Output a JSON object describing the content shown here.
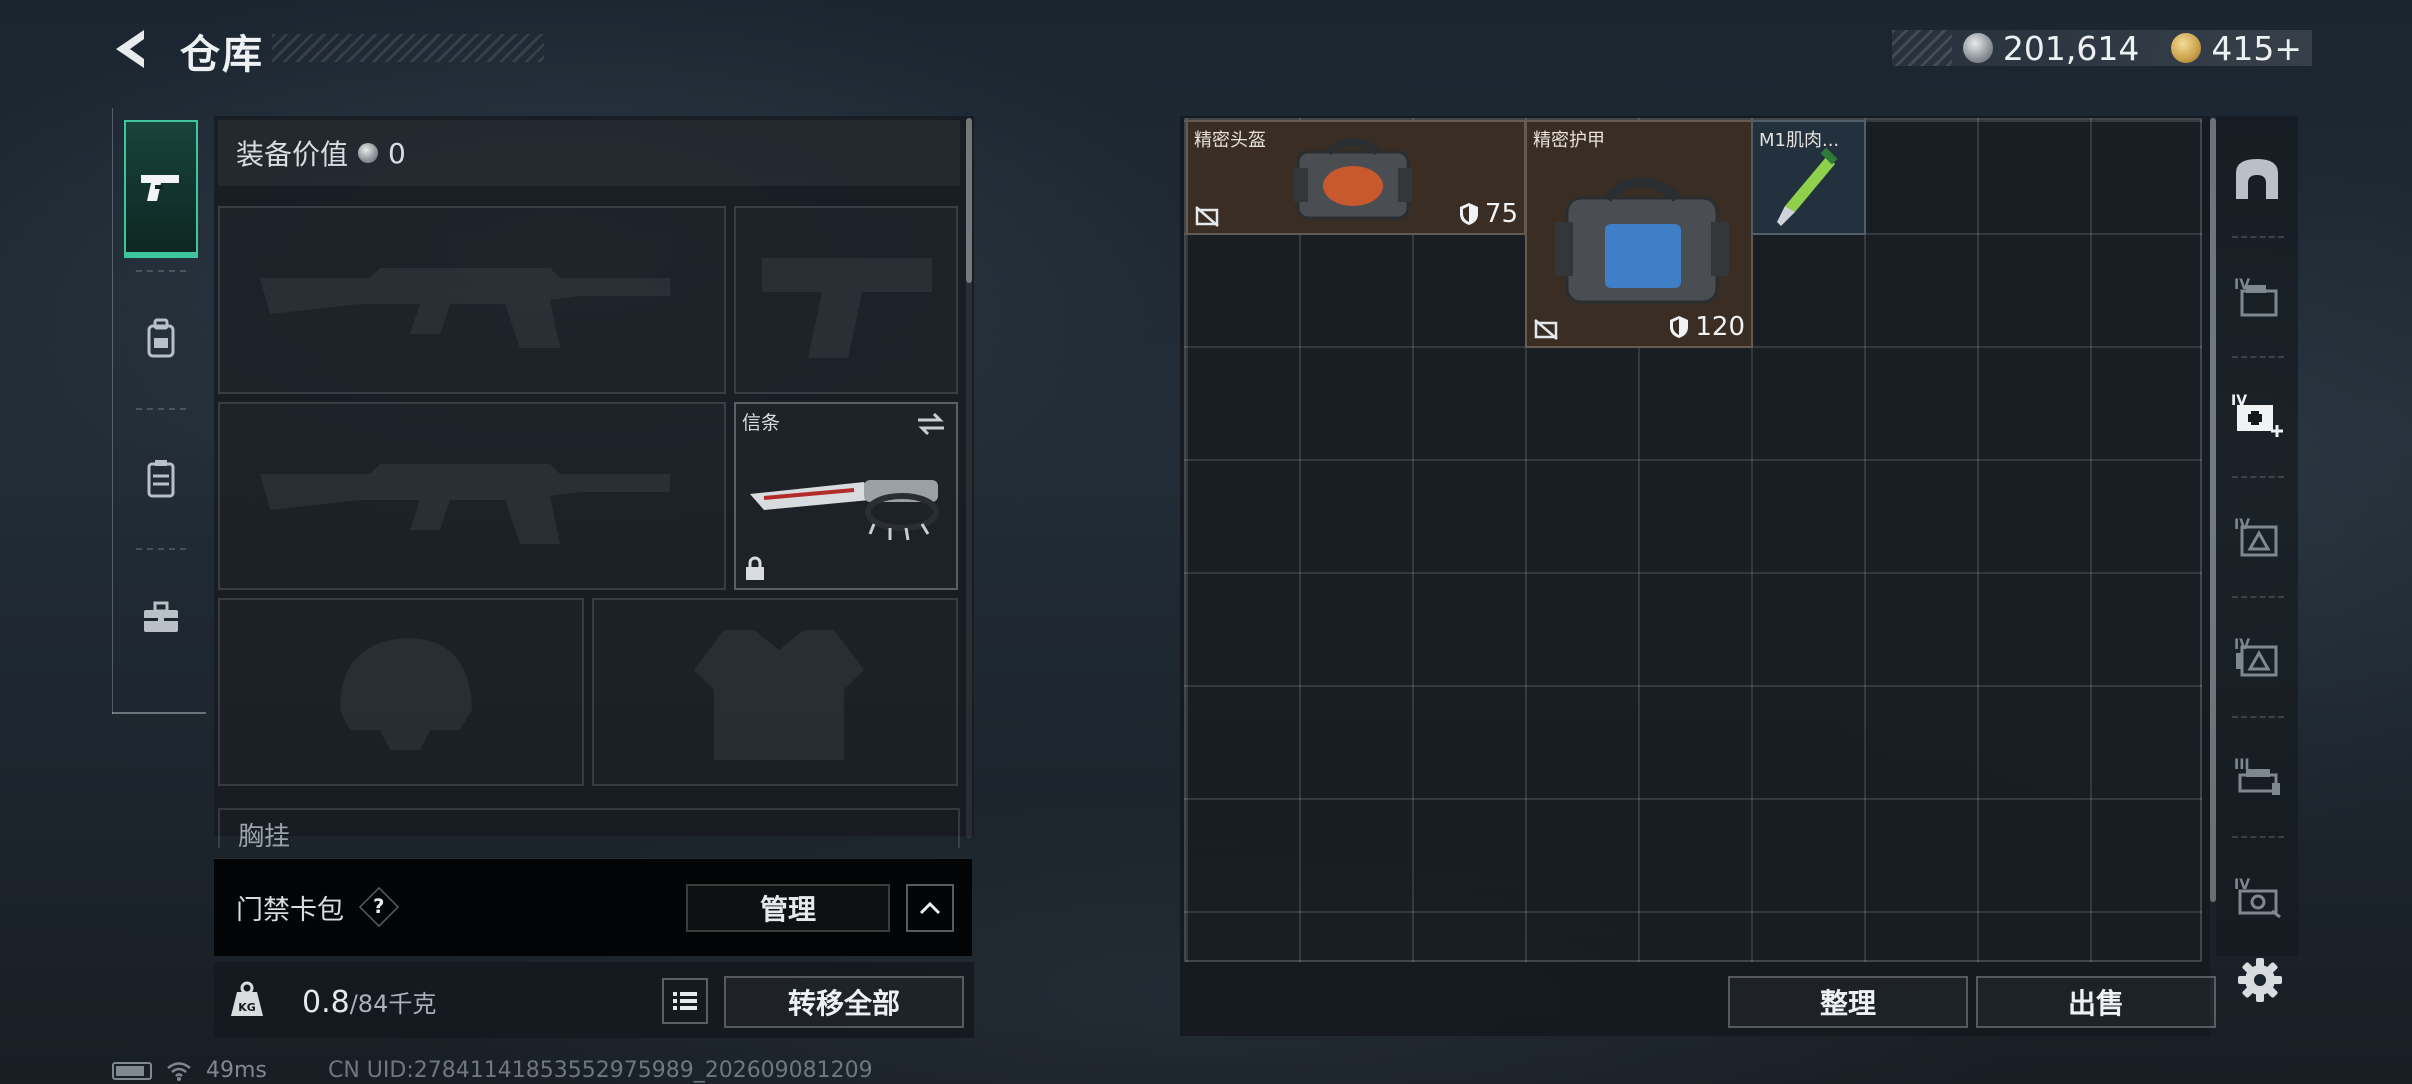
{
  "header": {
    "title": "仓库",
    "currency_silver": "201,614",
    "currency_gold": "415+"
  },
  "side_tabs": [
    {
      "icon": "pistol-icon",
      "active": true
    },
    {
      "icon": "backpack-icon",
      "active": false
    },
    {
      "icon": "chest-rig-icon",
      "active": false
    },
    {
      "icon": "toolbox-icon",
      "active": false
    }
  ],
  "equipment": {
    "value_label": "装备价值",
    "value": "0",
    "slots": [
      {
        "name": "primary-weapon-slot",
        "label": ""
      },
      {
        "name": "pistol-slot",
        "label": ""
      },
      {
        "name": "secondary-weapon-slot",
        "label": ""
      },
      {
        "name": "melee-slot",
        "label": "信条"
      },
      {
        "name": "helmet-slot",
        "label": ""
      },
      {
        "name": "armor-slot",
        "label": ""
      }
    ],
    "chest_label": "胸挂"
  },
  "keycard": {
    "label": "门禁卡包",
    "help": "?",
    "manage": "管理"
  },
  "weight": {
    "current": "0.8",
    "max": "/84千克",
    "transfer_all": "转移全部"
  },
  "status": {
    "ping": "49ms",
    "uid": "CN UID:2784114185355297598​9_202609081209"
  },
  "stash": {
    "items": [
      {
        "name": "精密头盔",
        "durability": "75",
        "kind": "helmet-case"
      },
      {
        "name": "精密护甲",
        "durability": "120",
        "kind": "armor-case"
      },
      {
        "name": "M1肌肉...",
        "durability": "",
        "kind": "injector"
      }
    ],
    "sort": "整理",
    "sell": "出售"
  },
  "right_tabs": [
    "safe-box-icon",
    "container-iv-icon",
    "container-iv-add-icon",
    "container-iv-a-icon",
    "container-iv-b-icon",
    "container-iii-icon",
    "container-iv-c-icon"
  ],
  "colors": {
    "accent": "#3ec79d",
    "item_brown": "#3a2d23",
    "item_blue": "#22313d"
  }
}
